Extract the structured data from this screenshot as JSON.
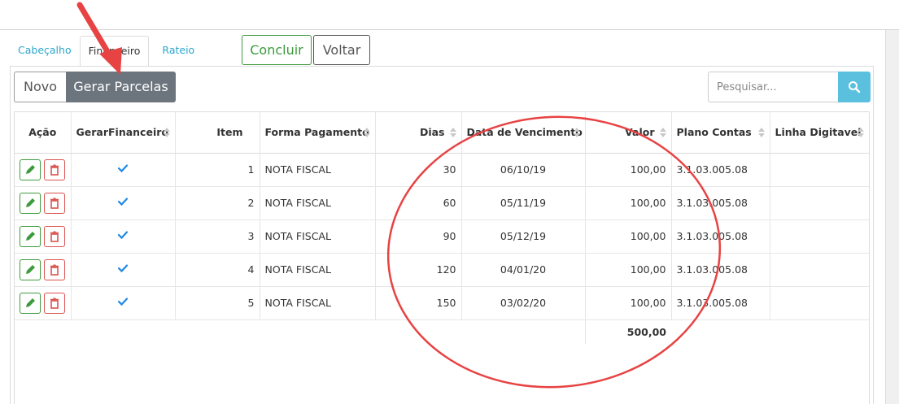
{
  "tabs": [
    {
      "label": "Cabeçalho",
      "active": false
    },
    {
      "label": "Financeiro",
      "active": true
    },
    {
      "label": "Rateio",
      "active": false
    }
  ],
  "actions": {
    "concluir": "Concluir",
    "voltar": "Voltar"
  },
  "toolbar": {
    "novo": "Novo",
    "gerar_parcelas": "Gerar Parcelas"
  },
  "search": {
    "placeholder": "Pesquisar..."
  },
  "table": {
    "headers": {
      "acao": "Ação",
      "gerar_financeiro": "GerarFinanceiro",
      "item": "Item",
      "forma_pagamento": "Forma Pagamento",
      "dias": "Dias",
      "data_vencimento": "Data de Vencimento",
      "valor": "Valor",
      "plano_contas": "Plano Contas",
      "linha_digitavel": "Linha Digitavel"
    },
    "rows": [
      {
        "item": "1",
        "forma": "NOTA FISCAL",
        "dias": "30",
        "vencimento": "06/10/19",
        "valor": "100,00",
        "plano": "3.1.03.005.08",
        "linha": ""
      },
      {
        "item": "2",
        "forma": "NOTA FISCAL",
        "dias": "60",
        "vencimento": "05/11/19",
        "valor": "100,00",
        "plano": "3.1.03.005.08",
        "linha": ""
      },
      {
        "item": "3",
        "forma": "NOTA FISCAL",
        "dias": "90",
        "vencimento": "05/12/19",
        "valor": "100,00",
        "plano": "3.1.03.005.08",
        "linha": ""
      },
      {
        "item": "4",
        "forma": "NOTA FISCAL",
        "dias": "120",
        "vencimento": "04/01/20",
        "valor": "100,00",
        "plano": "3.1.03.005.08",
        "linha": ""
      },
      {
        "item": "5",
        "forma": "NOTA FISCAL",
        "dias": "150",
        "vencimento": "03/02/20",
        "valor": "100,00",
        "plano": "3.1.03.005.08",
        "linha": ""
      }
    ],
    "total": "500,00"
  },
  "colors": {
    "accent_green": "#3c9b3c",
    "accent_red": "#d9534f",
    "search_btn": "#5bc0de",
    "tab_link": "#2ba6cb",
    "annotation": "#e84343"
  }
}
